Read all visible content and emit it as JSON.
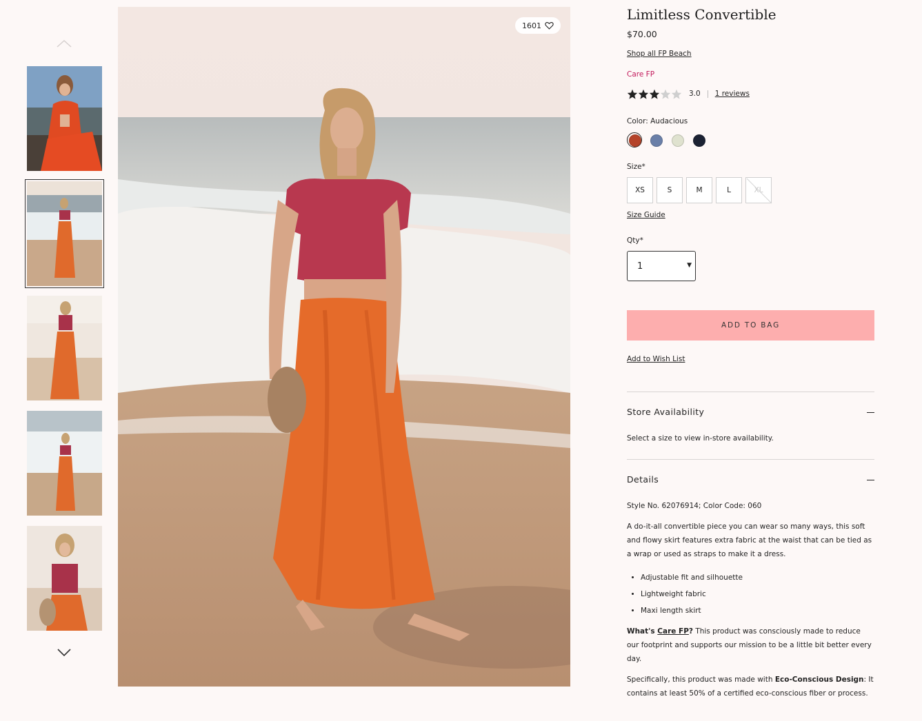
{
  "gallery": {
    "favorite_count": "1601",
    "thumbnails": [
      {
        "label": "red halter dress on rocks"
      },
      {
        "label": "beach walk, full length"
      },
      {
        "label": "back view on beach"
      },
      {
        "label": "walking in surf"
      },
      {
        "label": "close-up with bag"
      }
    ],
    "selected_index": 1
  },
  "product": {
    "title": "Limitless Convertible",
    "price": "$70.00",
    "shop_link": "Shop all FP Beach",
    "care_label": "Care FP",
    "rating": {
      "value": 3.0,
      "max": 5,
      "display": "3.0",
      "reviews_text": "1 reviews"
    },
    "color_label": "Color: Audacious",
    "swatches": [
      {
        "name": "Audacious",
        "color": "#b5432a",
        "selected": true
      },
      {
        "name": "Blue",
        "color": "#6a7fa8",
        "selected": false
      },
      {
        "name": "Sage",
        "color": "#dfe2cf",
        "selected": false
      },
      {
        "name": "Navy",
        "color": "#1b2233",
        "selected": false
      }
    ],
    "size_label": "Size*",
    "sizes": [
      {
        "label": "XS",
        "available": true
      },
      {
        "label": "S",
        "available": true
      },
      {
        "label": "M",
        "available": true
      },
      {
        "label": "L",
        "available": true
      },
      {
        "label": "XL",
        "available": false
      }
    ],
    "size_guide": "Size Guide",
    "qty_label": "Qty*",
    "qty_value": "1",
    "add_to_bag": "ADD TO BAG",
    "wish_list": "Add to Wish List"
  },
  "store_availability": {
    "title": "Store Availability",
    "text": "Select a size to view in-store availability."
  },
  "details": {
    "title": "Details",
    "style_line": "Style No. 62076914; Color Code: 060",
    "description": "A do-it-all convertible piece you can wear so many ways, this soft and flowy skirt features extra fabric at the waist that can be tied as a wrap or used as straps to make it a dress.",
    "bullets": [
      "Adjustable fit and silhouette",
      "Lightweight fabric",
      "Maxi length skirt"
    ],
    "care_prefix": "What's ",
    "care_link": "Care FP",
    "care_q": "?",
    "care_text": " This product was consciously made to reduce our footprint and supports our mission to be a little bit better every day.",
    "eco_prefix": "Specifically, this product was made with ",
    "eco_bold": "Eco-Conscious Design",
    "eco_text": ": It contains at least 50% of a certified eco-conscious fiber or process."
  },
  "colors": {
    "accent_pink": "#fdaeae",
    "care_magenta": "#c2185b",
    "page_bg": "#fdf8f7"
  }
}
